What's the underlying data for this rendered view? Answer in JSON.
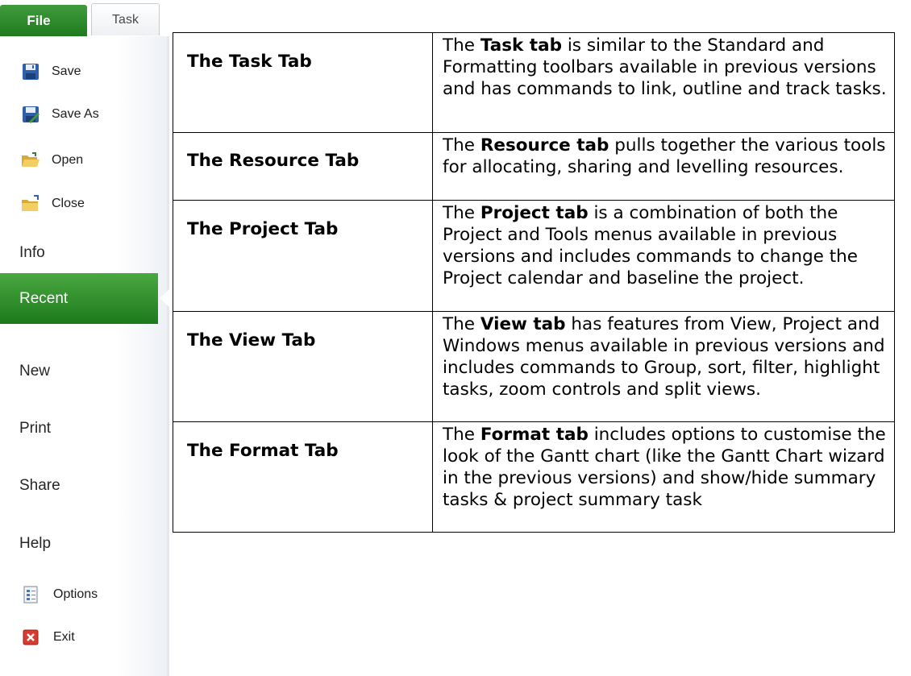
{
  "ribbon_tabs": {
    "file": "File",
    "task": "Task"
  },
  "backstage": {
    "commands": [
      {
        "label": "Save",
        "icon": "save-icon"
      },
      {
        "label": "Save As",
        "icon": "save-as-icon"
      },
      {
        "label": "Open",
        "icon": "open-folder-icon"
      },
      {
        "label": "Close",
        "icon": "close-folder-icon"
      }
    ],
    "info": "Info",
    "recent": "Recent",
    "new": "New",
    "print": "Print",
    "share": "Share",
    "help": "Help",
    "options": {
      "label": "Options",
      "icon": "options-icon"
    },
    "exit": {
      "label": "Exit",
      "icon": "exit-icon"
    },
    "accent_color": "#2a8a27"
  },
  "table": {
    "rows": [
      {
        "name": "The Task Tab",
        "bold": "Task tab",
        "before": "The ",
        "after": " is similar to the Standard and Formatting toolbars available in previous versions and has commands to link, outline and track tasks."
      },
      {
        "name": "The Resource Tab",
        "bold": "Resource tab",
        "before": "The ",
        "after": " pulls together the various tools for allocating, sharing and levelling resources."
      },
      {
        "name": "The Project Tab",
        "bold": "Project tab",
        "before": "The ",
        "after": " is a combination of both the Project and Tools menus available in previous versions and includes commands to change the Project calendar and baseline the project."
      },
      {
        "name": "The View Tab",
        "bold": "View tab",
        "before": "The ",
        "after": " has features from View, Project and Windows menus available in previous versions and includes commands to Group, sort, filter, highlight tasks, zoom controls and split views."
      },
      {
        "name": "The Format Tab",
        "bold": "Format tab",
        "before": "The ",
        "after": " includes options to customise the look of the Gantt chart (like the Gantt Chart wizard in the previous versions) and show/hide summary tasks & project summary task"
      }
    ]
  }
}
